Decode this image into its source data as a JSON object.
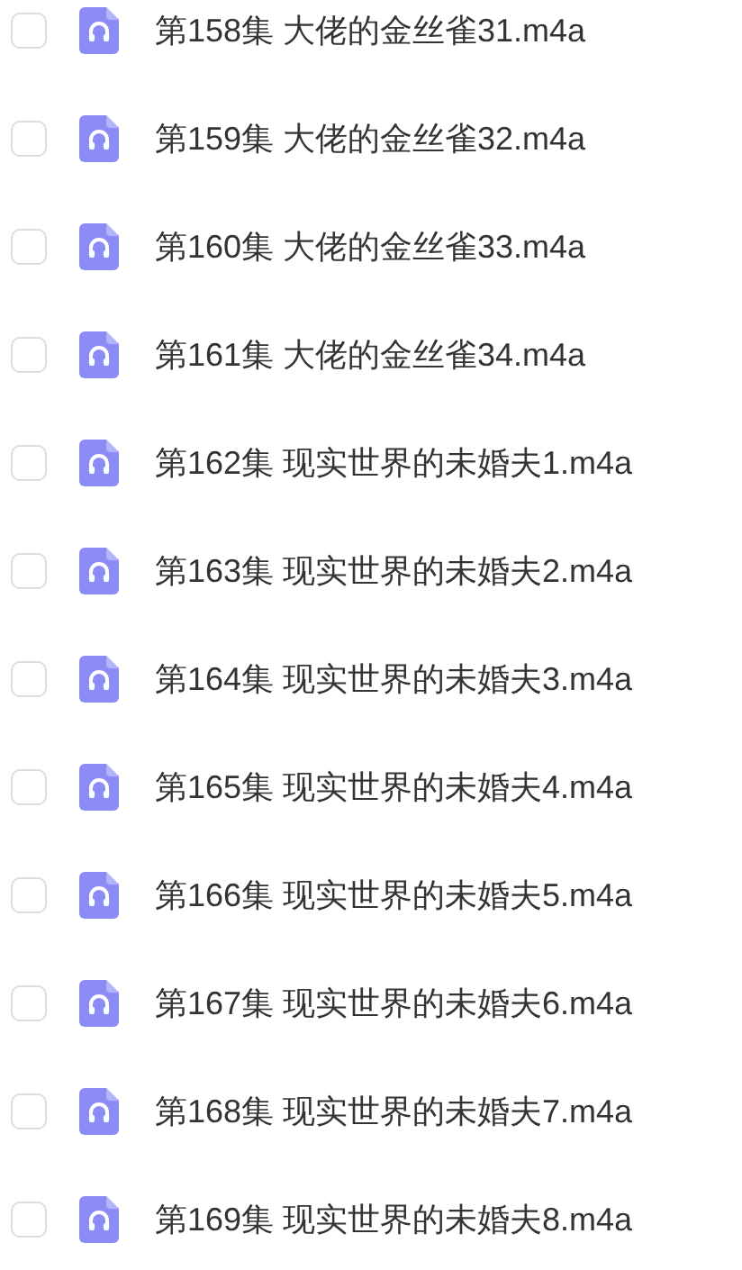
{
  "files": [
    {
      "name": "第158集 大佬的金丝雀31.m4a",
      "checked": false
    },
    {
      "name": "第159集 大佬的金丝雀32.m4a",
      "checked": false
    },
    {
      "name": "第160集 大佬的金丝雀33.m4a",
      "checked": false
    },
    {
      "name": "第161集 大佬的金丝雀34.m4a",
      "checked": false
    },
    {
      "name": "第162集 现实世界的未婚夫1.m4a",
      "checked": false
    },
    {
      "name": "第163集 现实世界的未婚夫2.m4a",
      "checked": false
    },
    {
      "name": "第164集 现实世界的未婚夫3.m4a",
      "checked": false
    },
    {
      "name": "第165集 现实世界的未婚夫4.m4a",
      "checked": false
    },
    {
      "name": "第166集 现实世界的未婚夫5.m4a",
      "checked": false
    },
    {
      "name": "第167集 现实世界的未婚夫6.m4a",
      "checked": false
    },
    {
      "name": "第168集 现实世界的未婚夫7.m4a",
      "checked": false
    },
    {
      "name": "第169集 现实世界的未婚夫8.m4a",
      "checked": false
    }
  ]
}
